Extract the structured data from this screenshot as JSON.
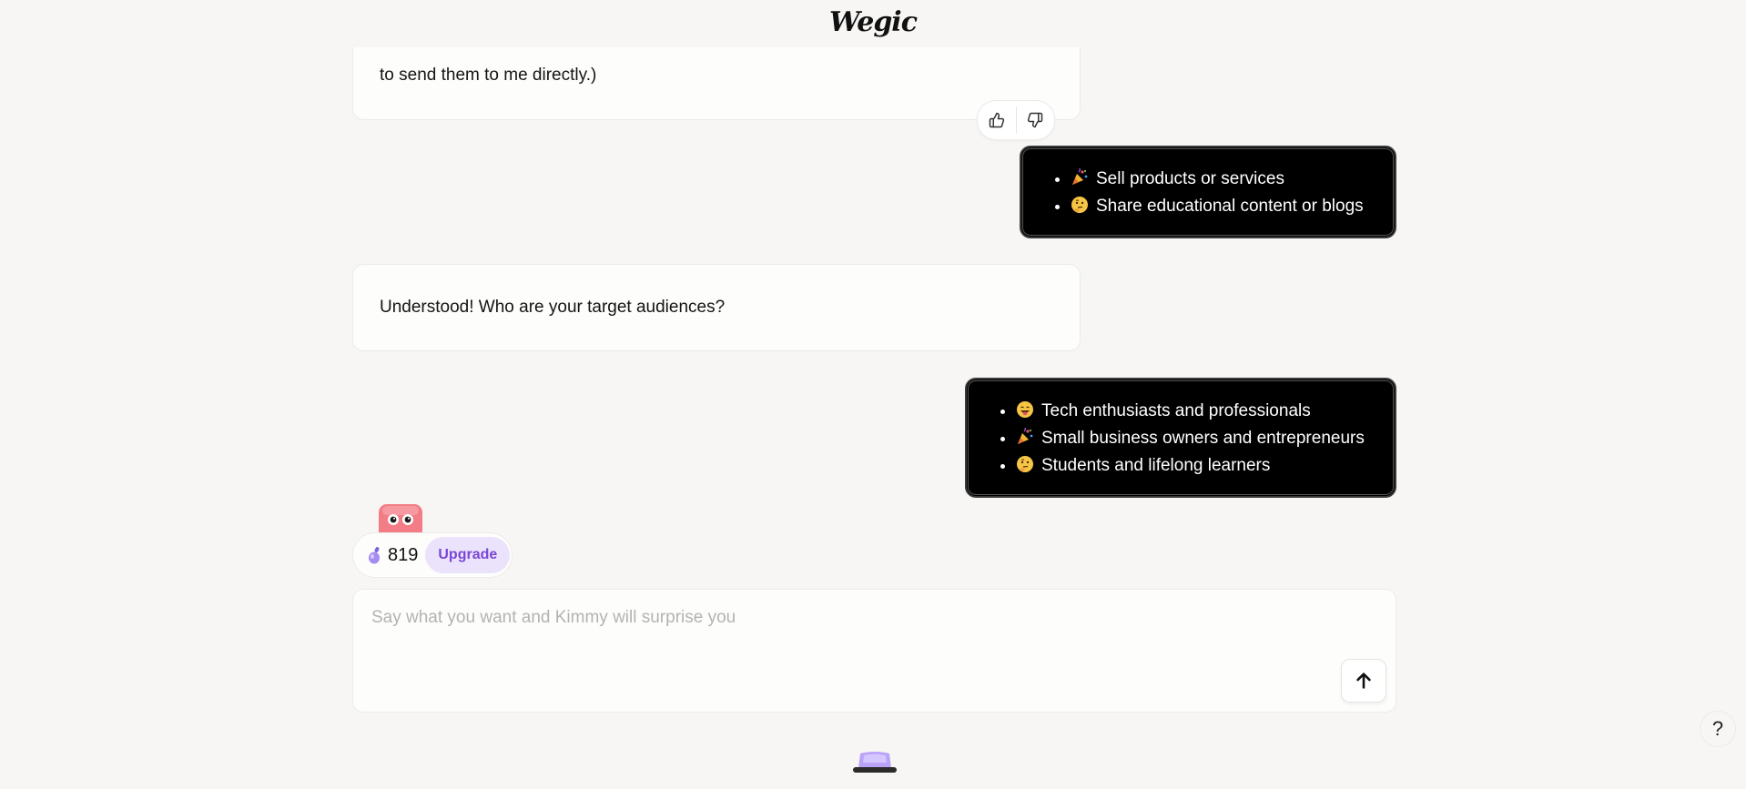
{
  "header": {
    "logo_text": "Wegic"
  },
  "messages": {
    "ai_partial": "to send them to me directly.)",
    "user_1": {
      "items": [
        {
          "emoji": "party-popper-icon",
          "text": "Sell products or services"
        },
        {
          "emoji": "thinking-face-icon",
          "text": "Share educational content or blogs"
        }
      ]
    },
    "ai_question": "Understood! Who are your target audiences?",
    "user_2": {
      "items": [
        {
          "emoji": "grinning-tongue-icon",
          "text": "Tech enthusiasts and professionals"
        },
        {
          "emoji": "party-popper-icon",
          "text": "Small business owners and entrepreneurs"
        },
        {
          "emoji": "thinking-face-icon",
          "text": "Students and lifelong learners"
        }
      ]
    }
  },
  "credits": {
    "count": "819",
    "upgrade_label": "Upgrade"
  },
  "composer": {
    "placeholder": "Say what you want and Kimmy will surprise you"
  },
  "help": {
    "label": "?"
  },
  "colors": {
    "background": "#f7f6f4",
    "user_bubble": "#000000",
    "upgrade_text": "#7a45d6",
    "upgrade_bg": "#ebe3fb",
    "mascot_pink": "#f27d86"
  }
}
